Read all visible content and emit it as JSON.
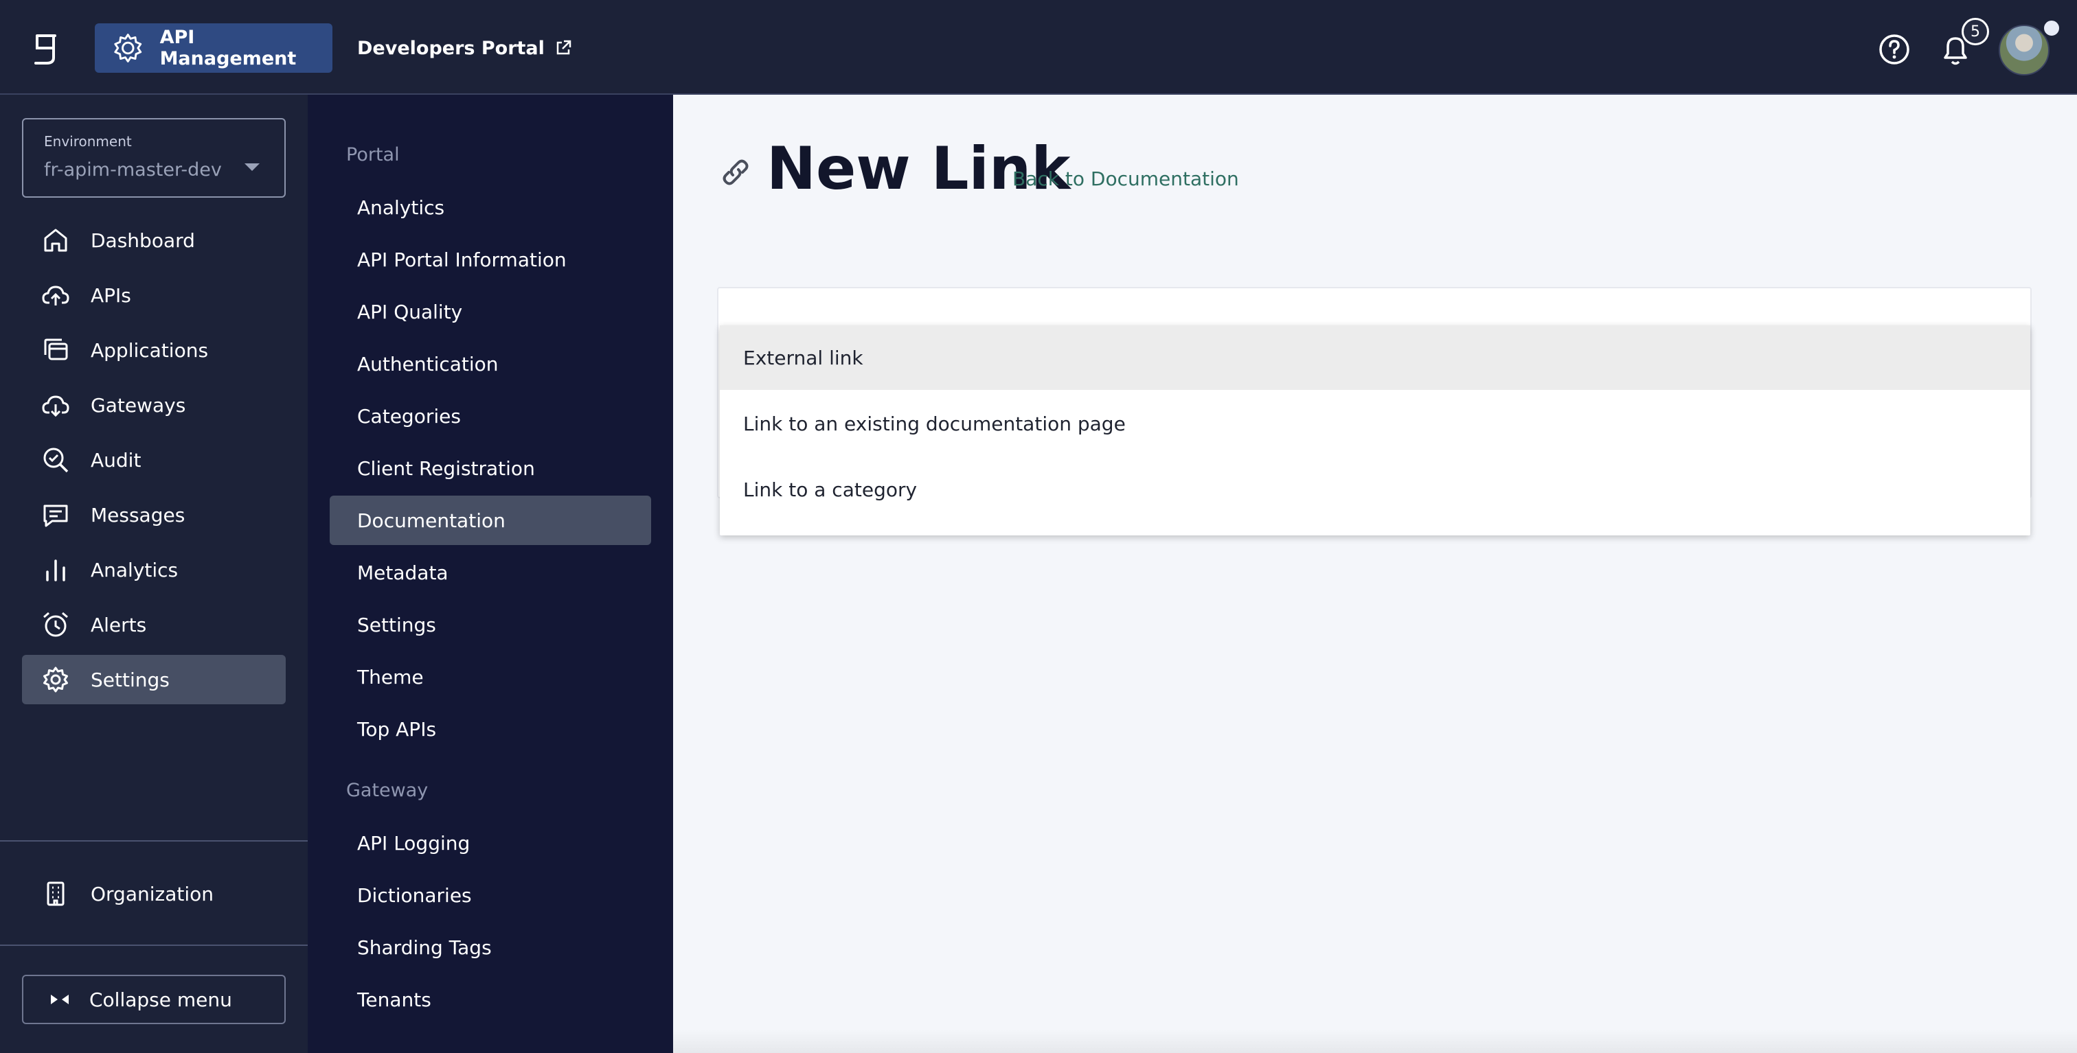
{
  "topbar": {
    "app_tab_label": "API Management",
    "portal_tab_label": "Developers Portal",
    "notification_count": "5"
  },
  "sidebar": {
    "environment": {
      "label": "Environment",
      "value": "fr-apim-master-dev"
    },
    "items": [
      {
        "label": "Dashboard",
        "icon": "home-icon"
      },
      {
        "label": "APIs",
        "icon": "cloud-upload-icon"
      },
      {
        "label": "Applications",
        "icon": "applications-icon"
      },
      {
        "label": "Gateways",
        "icon": "cloud-download-icon"
      },
      {
        "label": "Audit",
        "icon": "audit-search-icon"
      },
      {
        "label": "Messages",
        "icon": "message-icon"
      },
      {
        "label": "Analytics",
        "icon": "bar-chart-icon"
      },
      {
        "label": "Alerts",
        "icon": "alarm-clock-icon"
      },
      {
        "label": "Settings",
        "icon": "gear-icon",
        "active": true
      }
    ],
    "organization_label": "Organization",
    "collapse_label": "Collapse menu"
  },
  "submenu": {
    "groups": [
      {
        "title": "Portal",
        "items": [
          "Analytics",
          "API Portal Information",
          "API Quality",
          "Authentication",
          "Categories",
          "Client Registration",
          "Documentation",
          "Metadata",
          "Settings",
          "Theme",
          "Top APIs"
        ]
      },
      {
        "title": "Gateway",
        "items": [
          "API Logging",
          "Dictionaries",
          "Sharding Tags",
          "Tenants"
        ]
      }
    ],
    "active_item": "Documentation"
  },
  "main": {
    "title": "New Link",
    "back_link": "Back to Documentation",
    "dropdown_options": [
      "External link",
      "Link to an existing documentation page",
      "Link to a category"
    ],
    "highlighted_option": "External link"
  },
  "colors": {
    "topbar_bg": "#1c2238",
    "submenu_bg": "#131735",
    "accent_tab": "#2f4a82",
    "active_item_bg": "#474f64",
    "link_green": "#2f6f62"
  }
}
